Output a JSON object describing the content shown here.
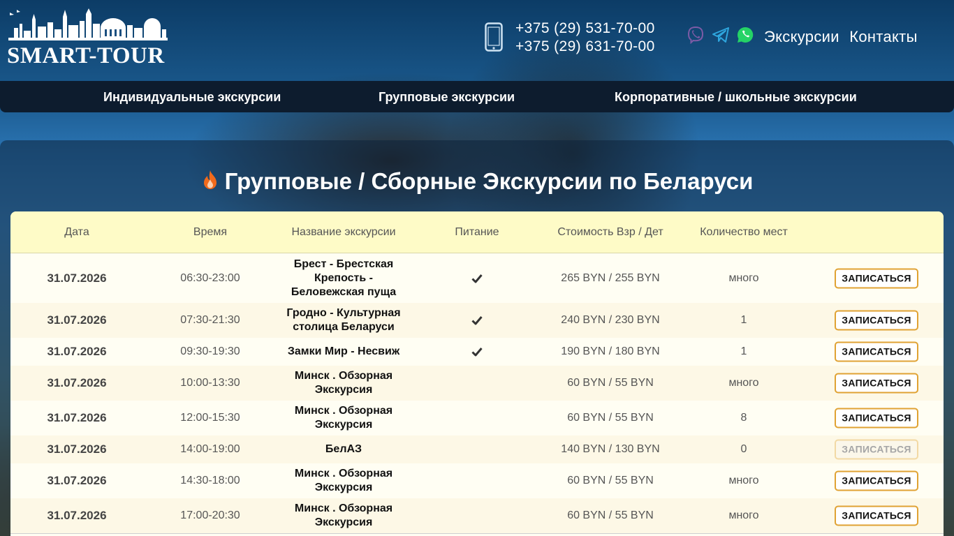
{
  "header": {
    "logo_text": "SMART-TOUR",
    "phones": [
      "+375 (29) 531-70-00",
      "+375 (29) 631-70-00"
    ],
    "social_icons": [
      "viber-icon",
      "telegram-icon",
      "whatsapp-icon"
    ],
    "links": [
      "Экскурсии",
      "Контакты"
    ]
  },
  "nav": {
    "items": [
      "Индивидуальные экскурсии",
      "Групповые экскурсии",
      "Корпоративные / школьные экскурсии"
    ]
  },
  "main": {
    "title": "Групповые / Сборные Экскурсии по Беларуси",
    "columns": [
      "Дата",
      "Время",
      "Название экскурсии",
      "Питание",
      "Стоимость Взр / Дет",
      "Количество мест",
      ""
    ],
    "rows": [
      {
        "date": "31.07.2026",
        "time": "06:30-23:00",
        "name": "Брест - Брестская Крепость - Беловежская пуща",
        "meal": true,
        "price": "265 BYN / 255 BYN",
        "seats": "много",
        "button": "ЗАПИСАТЬСЯ",
        "disabled": false
      },
      {
        "date": "31.07.2026",
        "time": "07:30-21:30",
        "name": "Гродно - Культурная столица Беларуси",
        "meal": true,
        "price": "240 BYN / 230 BYN",
        "seats": "1",
        "button": "ЗАПИСАТЬСЯ",
        "disabled": false
      },
      {
        "date": "31.07.2026",
        "time": "09:30-19:30",
        "name": "Замки Мир - Несвиж",
        "meal": true,
        "price": "190 BYN / 180 BYN",
        "seats": "1",
        "button": "ЗАПИСАТЬСЯ",
        "disabled": false
      },
      {
        "date": "31.07.2026",
        "time": "10:00-13:30",
        "name": "Минск . Обзорная Экскурсия",
        "meal": false,
        "price": "60 BYN / 55 BYN",
        "seats": "много",
        "button": "ЗАПИСАТЬСЯ",
        "disabled": false
      },
      {
        "date": "31.07.2026",
        "time": "12:00-15:30",
        "name": "Минск . Обзорная Экскурсия",
        "meal": false,
        "price": "60 BYN / 55 BYN",
        "seats": "8",
        "button": "ЗАПИСАТЬСЯ",
        "disabled": false
      },
      {
        "date": "31.07.2026",
        "time": "14:00-19:00",
        "name": "БелАЗ",
        "meal": false,
        "price": "140 BYN / 130 BYN",
        "seats": "0",
        "button": "ЗАПИСАТЬСЯ",
        "disabled": true
      },
      {
        "date": "31.07.2026",
        "time": "14:30-18:00",
        "name": "Минск . Обзорная Экскурсия",
        "meal": false,
        "price": "60 BYN / 55 BYN",
        "seats": "много",
        "button": "ЗАПИСАТЬСЯ",
        "disabled": false
      },
      {
        "date": "31.07.2026",
        "time": "17:00-20:30",
        "name": "Минск . Обзорная Экскурсия",
        "meal": false,
        "price": "60 BYN / 55 BYN",
        "seats": "много",
        "button": "ЗАПИСАТЬСЯ",
        "disabled": false
      }
    ]
  },
  "colors": {
    "nav_bg": "#0d1c2e",
    "table_header_bg": "#fefbc7",
    "button_border": "#e0a233",
    "fire": "#f26a1b",
    "viber": "#7d5ba6",
    "telegram": "#2ea6de",
    "whatsapp": "#25d366"
  }
}
